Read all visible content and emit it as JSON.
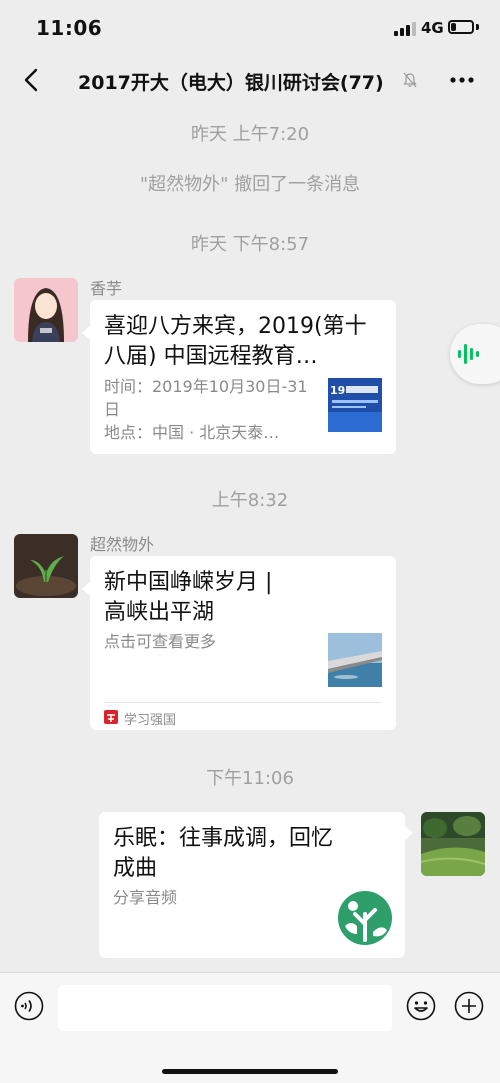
{
  "status_bar": {
    "time": "11:06",
    "network": "4G",
    "battery_level": 0.25
  },
  "nav": {
    "title": "2017开大（电大）银川研讨会(77)",
    "muted": true
  },
  "messages": [
    {
      "type": "timestamp",
      "text": "昨天 上午7:20"
    },
    {
      "type": "system",
      "text": "\"超然物外\" 撤回了一条消息"
    },
    {
      "type": "timestamp",
      "text": "昨天 下午8:57"
    },
    {
      "type": "link_card",
      "sender": "香芋",
      "direction": "incoming",
      "title": "喜迎八方来宾，2019(第十八届) 中国远程教育…",
      "desc": "时间：2019年10月30日-31日\n地点：中国 · 北京天泰…",
      "thumb_icon": "conference-poster"
    },
    {
      "type": "timestamp",
      "text": "上午8:32"
    },
    {
      "type": "link_card",
      "sender": "超然物外",
      "direction": "incoming",
      "title": "新中国峥嵘岁月 |\n高峡出平湖",
      "desc": "点击可查看更多",
      "source": "学习强国",
      "thumb_icon": "dam-photo"
    },
    {
      "type": "timestamp",
      "text": "下午11:06"
    },
    {
      "type": "music_card",
      "direction": "outgoing",
      "title": "乐眠：往事成调，回忆\n成曲",
      "desc": "分享音频",
      "thumb_icon": "tree-logo"
    }
  ],
  "colors": {
    "background": "#ededed",
    "bubble": "#ffffff",
    "muted_text": "#a0a0a0",
    "voice_green": "#07c160"
  }
}
